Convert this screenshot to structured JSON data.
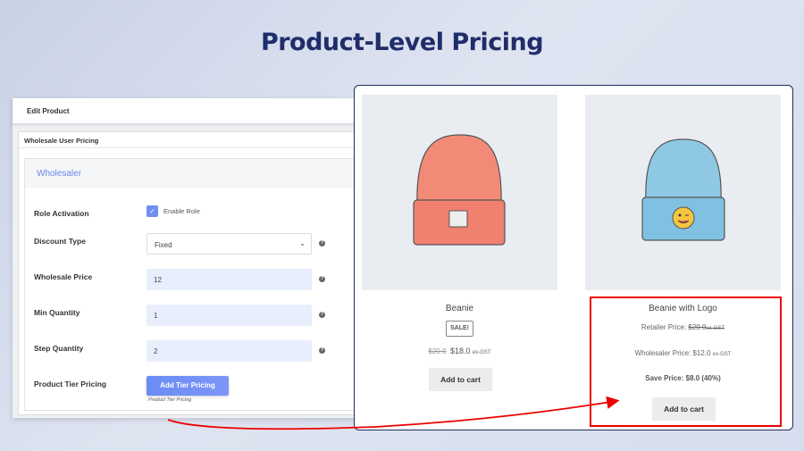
{
  "title": "Product-Level Pricing",
  "admin": {
    "header": "Edit Product",
    "box_title": "Wholesale User Pricing",
    "role": "Wholesaler",
    "role_activation_label": "Role Activation",
    "enable_role_label": "Enable Role",
    "enable_role_checked": true,
    "discount_type_label": "Discount Type",
    "discount_type_value": "Fixed",
    "wholesale_price_label": "Wholesale Price",
    "wholesale_price_value": "12",
    "min_qty_label": "Min Quantity",
    "min_qty_value": "1",
    "step_qty_label": "Step Quantity",
    "step_qty_value": "2",
    "tier_label": "Product Tier Pricing",
    "tier_button": "Add Tier Pricing",
    "tier_hint": "Product Tier Pricing",
    "help": "?"
  },
  "products": [
    {
      "name": "Beanie",
      "badge": "SALE!",
      "old_price": "$20.0",
      "price": "$18.0",
      "suffix": "ex-GST",
      "cart": "Add to cart",
      "color": "#f38a78"
    },
    {
      "name": "Beanie with Logo",
      "retailer_label": "Retailer Price:",
      "retailer_price": "$20.0",
      "retailer_suffix": "ex-GST",
      "wholesaler_label": "Wholesaler Price:",
      "wholesaler_price": "$12.0",
      "wholesaler_suffix": "ex-GST",
      "save": "Save Price: $8.0 (40%)",
      "cart": "Add to cart",
      "color": "#8fc8e4"
    }
  ]
}
